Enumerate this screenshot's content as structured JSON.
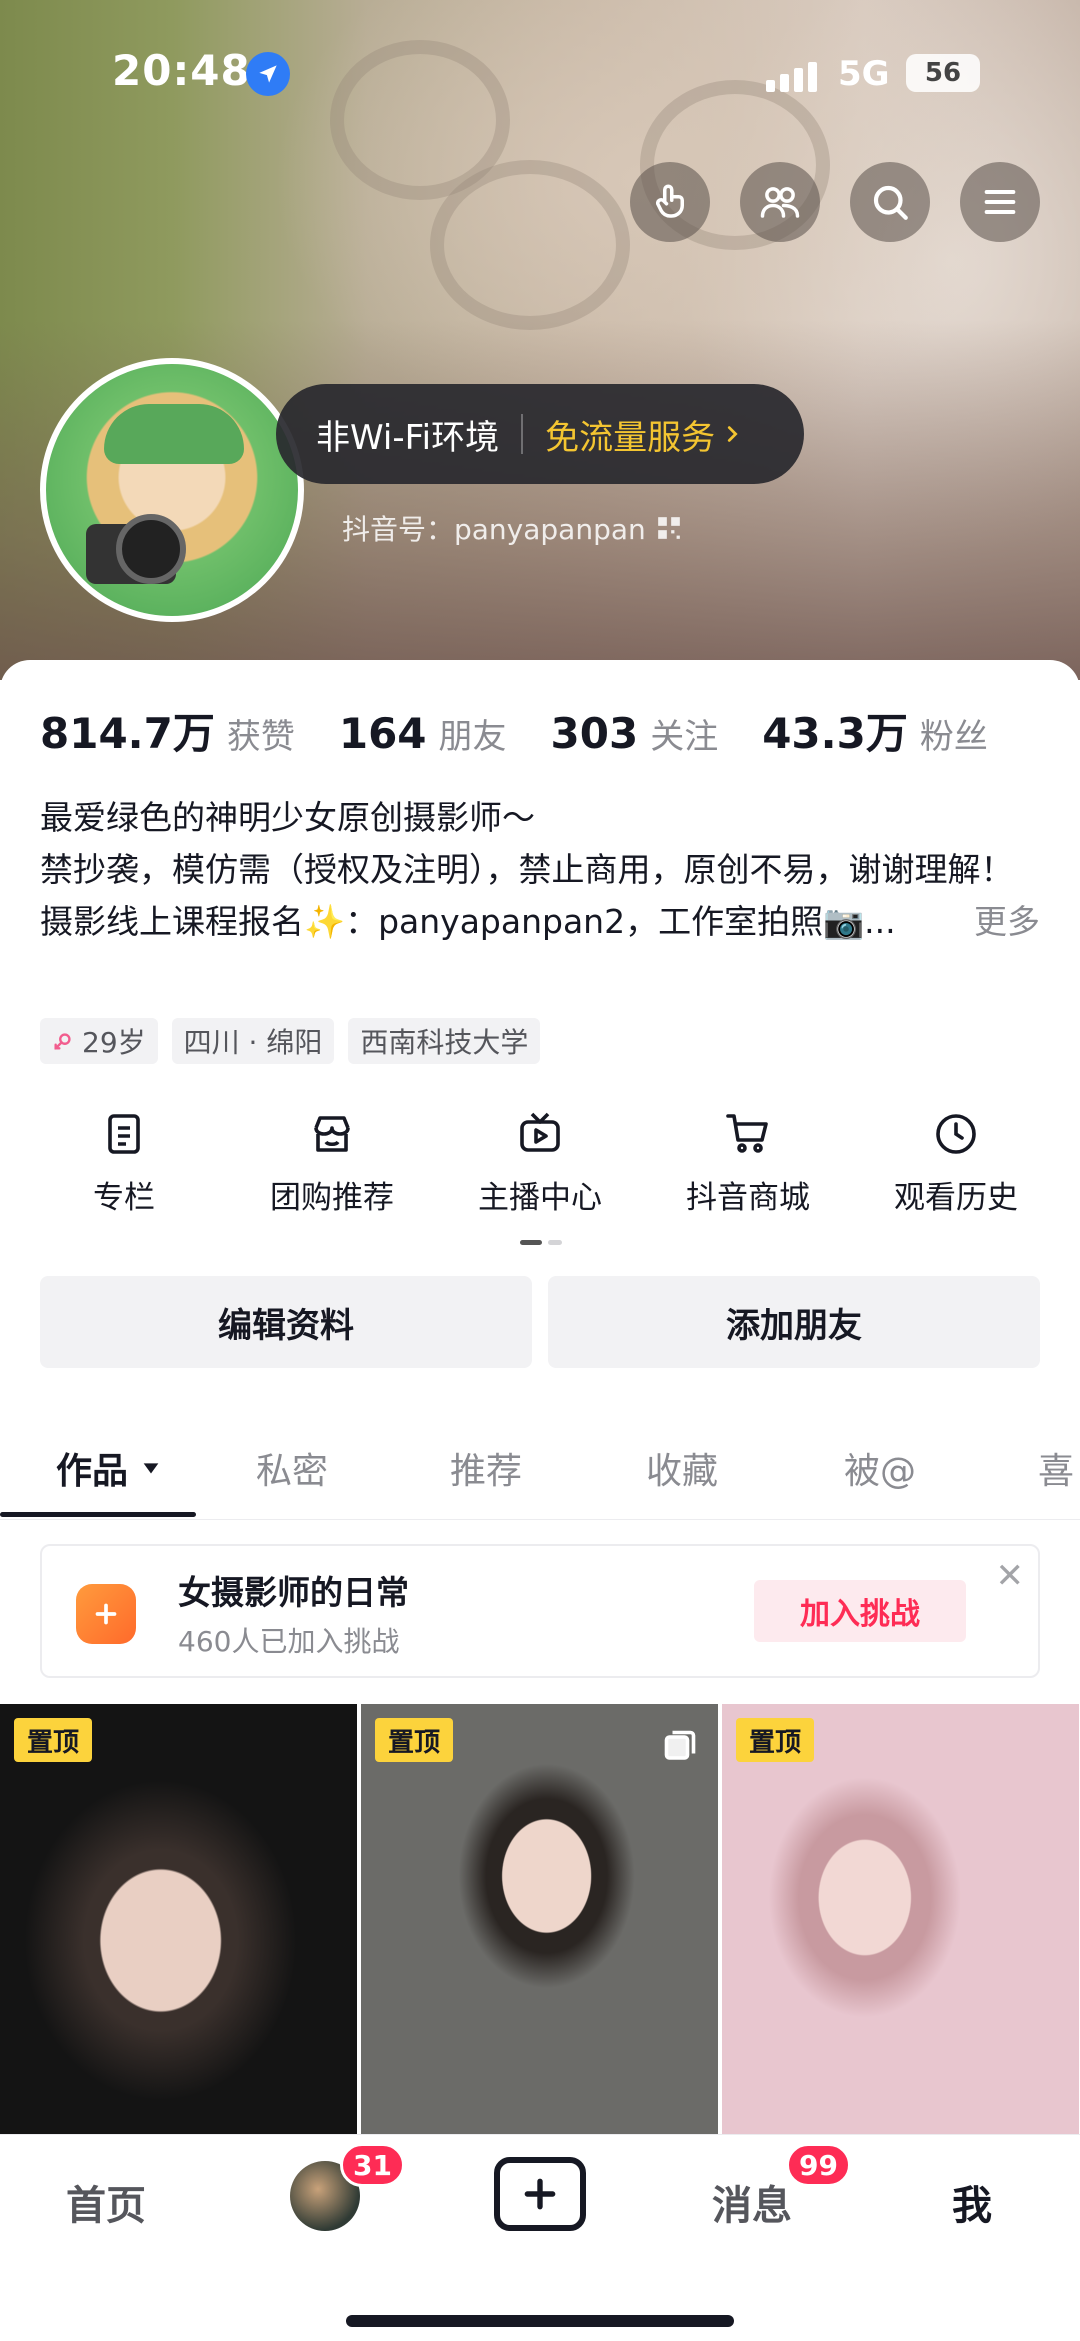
{
  "status_bar": {
    "time": "20:48",
    "network": "5G",
    "battery": "56"
  },
  "top_actions": [
    "hand-pointer-icon",
    "friends-icon",
    "search-icon",
    "menu-icon"
  ],
  "network_pill": {
    "left": "非Wi-Fi环境",
    "right": "免流量服务"
  },
  "profile": {
    "douyin_id": "抖音号：panyapanpan"
  },
  "stats": [
    {
      "num": "814.7万",
      "label": "获赞"
    },
    {
      "num": "164",
      "label": "朋友"
    },
    {
      "num": "303",
      "label": "关注"
    },
    {
      "num": "43.3万",
      "label": "粉丝"
    }
  ],
  "bio": {
    "line1": "最爱绿色的神明少女原创摄影师～",
    "line2": "禁抄袭，模仿需（授权及注明），禁止商用，原创不易，谢谢理解！",
    "line3": "摄影线上课程报名✨：panyapanpan2，工作室拍照📷...",
    "more": "更多"
  },
  "tags": {
    "age": "29岁",
    "location": "四川 · 绵阳",
    "school": "西南科技大学"
  },
  "shortcuts": [
    {
      "label": "专栏",
      "icon": "column-icon"
    },
    {
      "label": "团购推荐",
      "icon": "group-buy-icon"
    },
    {
      "label": "主播中心",
      "icon": "live-tv-icon"
    },
    {
      "label": "抖音商城",
      "icon": "cart-icon"
    },
    {
      "label": "观看历史",
      "icon": "clock-icon"
    }
  ],
  "actions": {
    "edit": "编辑资料",
    "add_friend": "添加朋友"
  },
  "tabs": [
    "作品",
    "私密",
    "推荐",
    "收藏",
    "被@",
    "喜"
  ],
  "challenge": {
    "title": "女摄影师的日常",
    "subtitle": "460人已加入挑战",
    "join": "加入挑战"
  },
  "grid": {
    "pin_label": "置顶"
  },
  "bottom_nav": {
    "home": "首页",
    "friends_badge": "31",
    "messages": "消息",
    "messages_badge": "99",
    "me": "我"
  }
}
